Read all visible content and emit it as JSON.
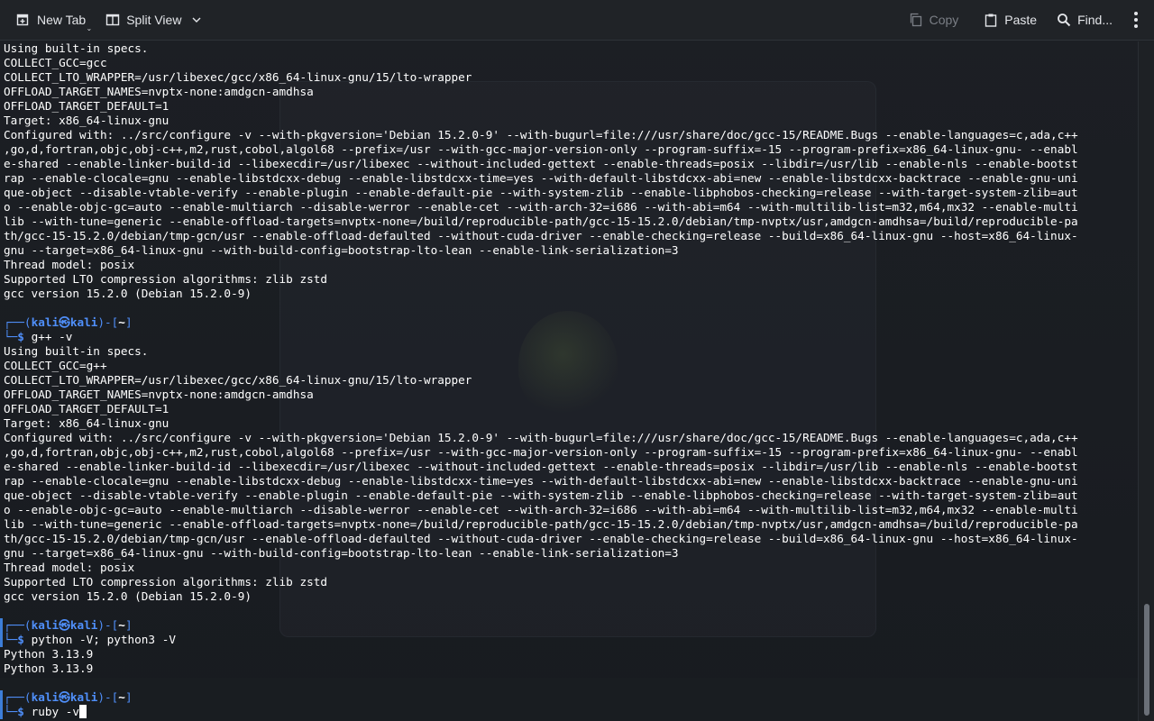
{
  "toolbar": {
    "new_tab": "New Tab",
    "split_view": "Split View",
    "copy": "Copy",
    "paste": "Paste",
    "find": "Find..."
  },
  "prompt": {
    "user": "kali",
    "at": "㉿",
    "host": "kali",
    "dir": "~"
  },
  "output_top": [
    "Using built-in specs.",
    "COLLECT_GCC=gcc",
    "COLLECT_LTO_WRAPPER=/usr/libexec/gcc/x86_64-linux-gnu/15/lto-wrapper",
    "OFFLOAD_TARGET_NAMES=nvptx-none:amdgcn-amdhsa",
    "OFFLOAD_TARGET_DEFAULT=1",
    "Target: x86_64-linux-gnu",
    "Configured with: ../src/configure -v --with-pkgversion='Debian 15.2.0-9' --with-bugurl=file:///usr/share/doc/gcc-15/README.Bugs --enable-languages=c,ada,c++",
    ",go,d,fortran,objc,obj-c++,m2,rust,cobol,algol68 --prefix=/usr --with-gcc-major-version-only --program-suffix=-15 --program-prefix=x86_64-linux-gnu- --enabl",
    "e-shared --enable-linker-build-id --libexecdir=/usr/libexec --without-included-gettext --enable-threads=posix --libdir=/usr/lib --enable-nls --enable-bootst",
    "rap --enable-clocale=gnu --enable-libstdcxx-debug --enable-libstdcxx-time=yes --with-default-libstdcxx-abi=new --enable-libstdcxx-backtrace --enable-gnu-uni",
    "que-object --disable-vtable-verify --enable-plugin --enable-default-pie --with-system-zlib --enable-libphobos-checking=release --with-target-system-zlib=aut",
    "o --enable-objc-gc=auto --enable-multiarch --disable-werror --enable-cet --with-arch-32=i686 --with-abi=m64 --with-multilib-list=m32,m64,mx32 --enable-multi",
    "lib --with-tune=generic --enable-offload-targets=nvptx-none=/build/reproducible-path/gcc-15-15.2.0/debian/tmp-nvptx/usr,amdgcn-amdhsa=/build/reproducible-pa",
    "th/gcc-15-15.2.0/debian/tmp-gcn/usr --enable-offload-defaulted --without-cuda-driver --enable-checking=release --build=x86_64-linux-gnu --host=x86_64-linux-",
    "gnu --target=x86_64-linux-gnu --with-build-config=bootstrap-lto-lean --enable-link-serialization=3",
    "Thread model: posix",
    "Supported LTO compression algorithms: zlib zstd",
    "gcc version 15.2.0 (Debian 15.2.0-9)"
  ],
  "cmd1": "g++ -v",
  "output_gpp": [
    "Using built-in specs.",
    "COLLECT_GCC=g++",
    "COLLECT_LTO_WRAPPER=/usr/libexec/gcc/x86_64-linux-gnu/15/lto-wrapper",
    "OFFLOAD_TARGET_NAMES=nvptx-none:amdgcn-amdhsa",
    "OFFLOAD_TARGET_DEFAULT=1",
    "Target: x86_64-linux-gnu",
    "Configured with: ../src/configure -v --with-pkgversion='Debian 15.2.0-9' --with-bugurl=file:///usr/share/doc/gcc-15/README.Bugs --enable-languages=c,ada,c++",
    ",go,d,fortran,objc,obj-c++,m2,rust,cobol,algol68 --prefix=/usr --with-gcc-major-version-only --program-suffix=-15 --program-prefix=x86_64-linux-gnu- --enabl",
    "e-shared --enable-linker-build-id --libexecdir=/usr/libexec --without-included-gettext --enable-threads=posix --libdir=/usr/lib --enable-nls --enable-bootst",
    "rap --enable-clocale=gnu --enable-libstdcxx-debug --enable-libstdcxx-time=yes --with-default-libstdcxx-abi=new --enable-libstdcxx-backtrace --enable-gnu-uni",
    "que-object --disable-vtable-verify --enable-plugin --enable-default-pie --with-system-zlib --enable-libphobos-checking=release --with-target-system-zlib=aut",
    "o --enable-objc-gc=auto --enable-multiarch --disable-werror --enable-cet --with-arch-32=i686 --with-abi=m64 --with-multilib-list=m32,m64,mx32 --enable-multi",
    "lib --with-tune=generic --enable-offload-targets=nvptx-none=/build/reproducible-path/gcc-15-15.2.0/debian/tmp-nvptx/usr,amdgcn-amdhsa=/build/reproducible-pa",
    "th/gcc-15-15.2.0/debian/tmp-gcn/usr --enable-offload-defaulted --without-cuda-driver --enable-checking=release --build=x86_64-linux-gnu --host=x86_64-linux-",
    "gnu --target=x86_64-linux-gnu --with-build-config=bootstrap-lto-lean --enable-link-serialization=3",
    "Thread model: posix",
    "Supported LTO compression algorithms: zlib zstd",
    "gcc version 15.2.0 (Debian 15.2.0-9)"
  ],
  "cmd2": "python -V; python3 -V",
  "output_python": [
    "Python 3.13.9",
    "Python 3.13.9"
  ],
  "cmd3": "ruby -v"
}
